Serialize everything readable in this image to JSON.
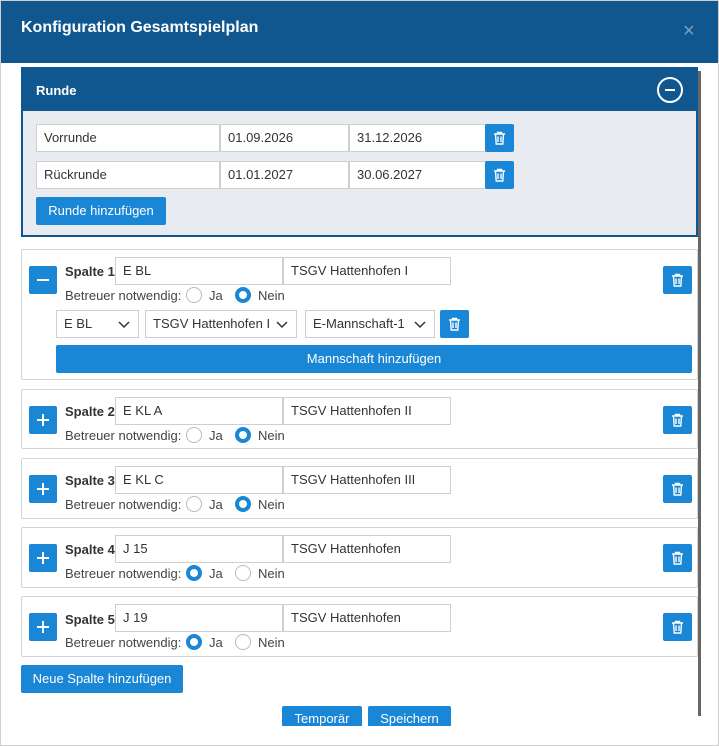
{
  "header": {
    "title": "Konfiguration Gesamtspielplan",
    "close_symbol": "×"
  },
  "runde": {
    "label": "Runde",
    "rows": [
      {
        "name": "Vorrunde",
        "start": "01.09.2026",
        "end": "31.12.2026"
      },
      {
        "name": "Rückrunde",
        "start": "01.01.2027",
        "end": "30.06.2027"
      }
    ],
    "add_label": "Runde hinzufügen"
  },
  "betreuer_label": "Betreuer notwendig:",
  "ja_label": "Ja",
  "nein_label": "Nein",
  "spalten": [
    {
      "label": "Spalte 1",
      "kuerzel": "E BL",
      "verein": "TSGV Hattenhofen I",
      "betreuer": "Nein",
      "expanded": true
    },
    {
      "label": "Spalte 2",
      "kuerzel": "E KL A",
      "verein": "TSGV Hattenhofen II",
      "betreuer": "Nein",
      "expanded": false
    },
    {
      "label": "Spalte 3",
      "kuerzel": "E KL C",
      "verein": "TSGV Hattenhofen III",
      "betreuer": "Nein",
      "expanded": false
    },
    {
      "label": "Spalte 4",
      "kuerzel": "J 15",
      "verein": "TSGV Hattenhofen",
      "betreuer": "Ja",
      "expanded": false
    },
    {
      "label": "Spalte 5",
      "kuerzel": "J 19",
      "verein": "TSGV Hattenhofen",
      "betreuer": "Ja",
      "expanded": false
    }
  ],
  "mannschaft": {
    "liga": "E BL",
    "verein": "TSGV Hattenhofen I",
    "team": "E-Mannschaft-1",
    "add_label": "Mannschaft hinzufügen"
  },
  "footer": {
    "neue_spalte_label": "Neue Spalte hinzufügen",
    "temporaer_label": "Temporär",
    "speichern_label": "Speichern"
  },
  "colors": {
    "header": "#11578f",
    "accent": "#1a86d6",
    "panel_bg": "#e8ecf1"
  }
}
